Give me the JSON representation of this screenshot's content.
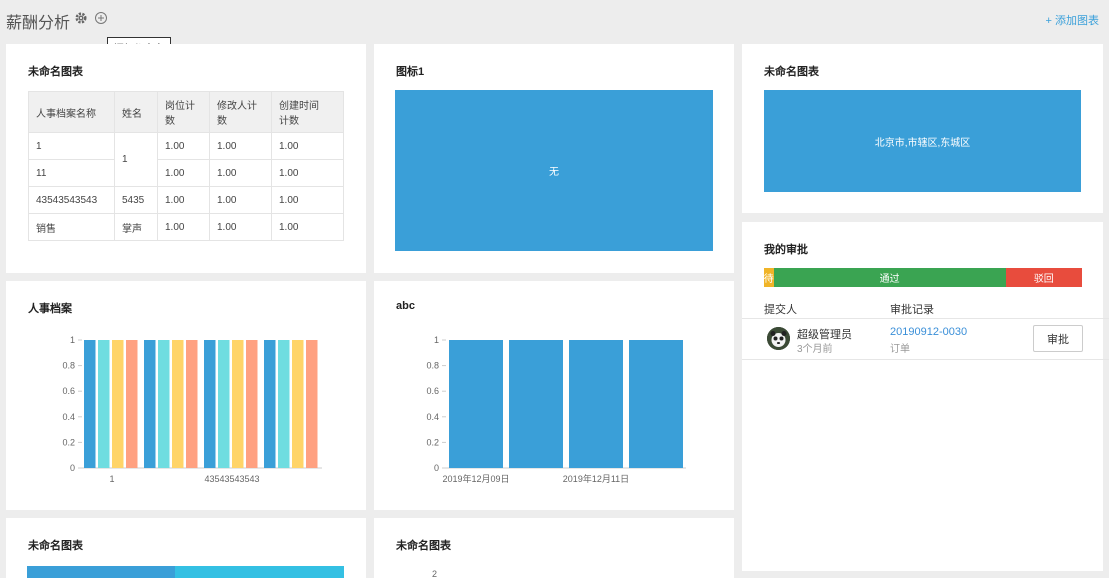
{
  "header": {
    "title": "薪酬分析",
    "tooltip": "添加仪表盘",
    "add_chart": "+ 添加图表"
  },
  "table_card": {
    "title": "未命名图表",
    "columns": [
      "人事档案名称",
      "姓名",
      "岗位计数",
      "修改人计数",
      "创建时间计数"
    ],
    "column_lines": [
      [
        "人事档案名称"
      ],
      [
        "姓名"
      ],
      [
        "岗位计",
        "数"
      ],
      [
        "修改人计",
        "数"
      ],
      [
        "创建时间",
        "计数"
      ]
    ],
    "rows": [
      [
        "1",
        "1",
        "1.00",
        "1.00",
        "1.00"
      ],
      [
        "11",
        "",
        "1.00",
        "1.00",
        "1.00"
      ],
      [
        "43543543543",
        "5435",
        "1.00",
        "1.00",
        "1.00"
      ],
      [
        "销售",
        "掌声",
        "1.00",
        "1.00",
        "1.00"
      ]
    ]
  },
  "indicator_card": {
    "title": "图标1",
    "value": "无"
  },
  "map_card": {
    "title": "未命名图表",
    "value": "北京市,市辖区,东城区"
  },
  "approval_card": {
    "title": "我的审批",
    "bar": [
      {
        "label": "待",
        "fraction": 0.03,
        "color": "#f0b428"
      },
      {
        "label": "通过",
        "fraction": 0.73,
        "color": "#3aa452"
      },
      {
        "label": "驳回",
        "fraction": 0.24,
        "color": "#e84c3d"
      }
    ],
    "col_submitter": "提交人",
    "col_record": "审批记录",
    "item": {
      "name": "超级管理员",
      "time": "3个月前",
      "record_id": "20190912-0030",
      "record_type": "订单",
      "button": "审批"
    }
  },
  "bottom_cards": {
    "left_title": "未命名图表",
    "mid_title": "未命名图表",
    "mid_tick": "2"
  },
  "chart_data": [
    {
      "type": "bar",
      "title": "人事档案",
      "categories": [
        "1",
        "",
        "43543543543",
        ""
      ],
      "series": [
        {
          "values": [
            1,
            1,
            1,
            1
          ],
          "color": "#3a9fd8"
        },
        {
          "values": [
            1,
            1,
            1,
            1
          ],
          "color": "#6fdde0"
        },
        {
          "values": [
            1,
            1,
            1,
            1
          ],
          "color": "#ffd468"
        },
        {
          "values": [
            1,
            1,
            1,
            1
          ],
          "color": "#ffa181"
        }
      ],
      "ylim": [
        0,
        1
      ],
      "yticks": [
        "0",
        "0.2",
        "0.4",
        "0.6",
        "0.8",
        "1"
      ]
    },
    {
      "type": "bar",
      "title": "abc",
      "categories": [
        "2019年12月09日",
        "",
        "2019年12月11日",
        ""
      ],
      "series": [
        {
          "values": [
            1,
            1,
            1,
            1
          ],
          "color": "#3a9fd8"
        }
      ],
      "ylim": [
        0,
        1
      ],
      "yticks": [
        "0",
        "0.2",
        "0.4",
        "0.6",
        "0.8",
        "1"
      ]
    }
  ]
}
